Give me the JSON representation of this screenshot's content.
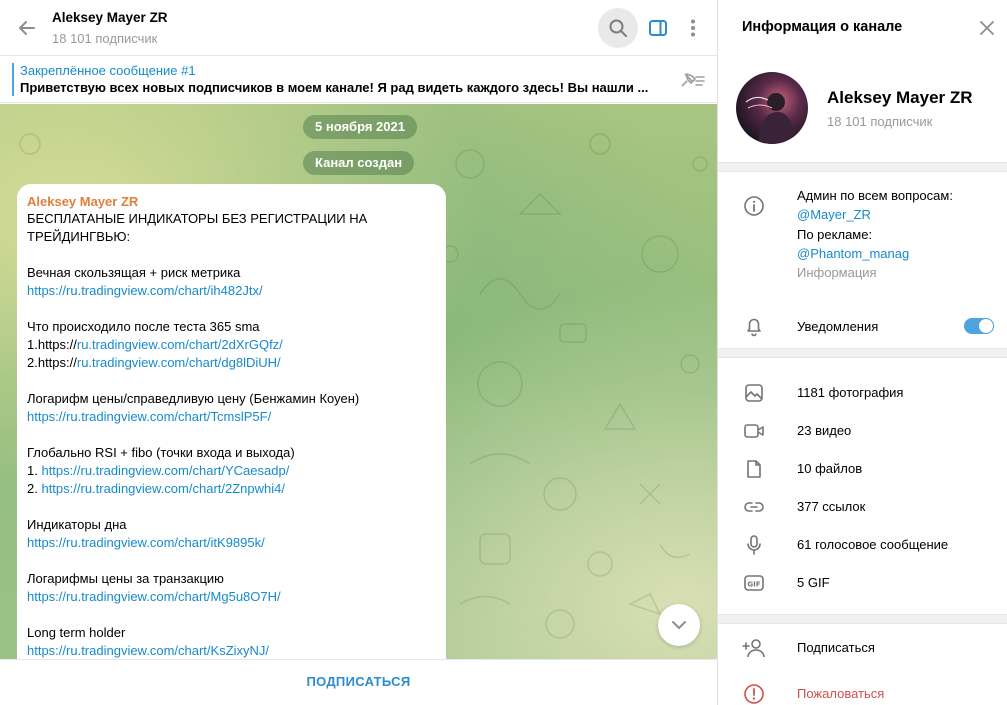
{
  "chat": {
    "title": "Aleksey Mayer ZR",
    "subtitle": "18 101 подписчик",
    "pinned": {
      "label": "Закреплённое сообщение #1",
      "text": "Приветствую всех новых подписчиков в моем канале! Я рад видеть каждого здесь! Вы нашли ..."
    },
    "service": {
      "date": "5 ноября 2021",
      "created": "Канал создан"
    },
    "message": {
      "author": "Aleksey Mayer ZR",
      "lines": [
        {
          "text": "БЕСПЛАТАНЫЕ ИНДИКАТОРЫ БЕЗ РЕГИСТРАЦИИ НА"
        },
        {
          "text": "ТРЕЙДИНГВЬЮ:"
        },
        {
          "text": ""
        },
        {
          "text": "Вечная скользящая + риск метрика"
        },
        {
          "link": "https://ru.tradingview.com/chart/ih482Jtx/"
        },
        {
          "text": ""
        },
        {
          "text": "Что происходило после теста 365 sma"
        },
        {
          "text": "1.https://",
          "link": "ru.tradingview.com/chart/2dXrGQfz/"
        },
        {
          "text": "2.https://",
          "link": "ru.tradingview.com/chart/dg8lDiUH/"
        },
        {
          "text": ""
        },
        {
          "text": "Логарифм цены/справедливую цену (Бенжамин Коуен)"
        },
        {
          "link": "https://ru.tradingview.com/chart/TcmslP5F/"
        },
        {
          "text": ""
        },
        {
          "text": "Глобально RSI + fibo (точки входа и выхода)"
        },
        {
          "text": "1. ",
          "link": "https://ru.tradingview.com/chart/YCaesadp/"
        },
        {
          "text": "2. ",
          "link": "https://ru.tradingview.com/chart/2Znpwhi4/"
        },
        {
          "text": ""
        },
        {
          "text": "Индикаторы дна"
        },
        {
          "link": "https://ru.tradingview.com/chart/itK9895k/"
        },
        {
          "text": ""
        },
        {
          "text": "Логарифмы цены за транзакцию"
        },
        {
          "link": "https://ru.tradingview.com/chart/Mg5u8O7H/"
        },
        {
          "text": ""
        },
        {
          "text": "Long term holder"
        },
        {
          "link": "https://ru.tradingview.com/chart/KsZixyNJ/"
        }
      ]
    },
    "subscribe_label": "ПОДПИСАТЬСЯ"
  },
  "info": {
    "header": "Информация о канале",
    "name": "Aleksey Mayer ZR",
    "subscribers": "18 101 подписчик",
    "description": {
      "line1": "Админ по всем вопросам:",
      "link1": "@Mayer_ZR",
      "line2": "По рекламе:",
      "link2": "@Phantom_manag",
      "caption": "Информация"
    },
    "notifications": {
      "label": "Уведомления",
      "enabled": true
    },
    "media": {
      "photos": "1181 фотография",
      "videos": "23 видео",
      "files": "10 файлов",
      "links": "377 ссылок",
      "voice": "61 голосовое сообщение",
      "gifs": "5 GIF"
    },
    "actions": {
      "subscribe": "Подписаться",
      "report": "Пожаловаться"
    }
  },
  "colors": {
    "accent": "#4fa3e0",
    "link": "#168acd",
    "author": "#e17f3b",
    "danger": "#d14e4e"
  }
}
